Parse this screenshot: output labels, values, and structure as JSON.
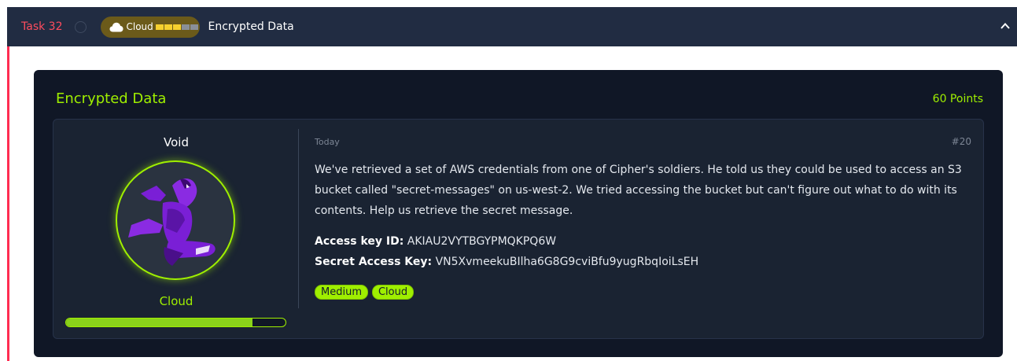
{
  "task": {
    "label": "Task 32",
    "category_pill": "Cloud",
    "difficulty_bars": [
      "#f6d02f",
      "#f6d02f",
      "#f6d02f",
      "#8a8f98",
      "#8a8f98"
    ],
    "title": "Encrypted Data"
  },
  "challenge": {
    "title": "Encrypted Data",
    "points": "60 Points",
    "author": "Void",
    "category": "Cloud",
    "progress": 0.85,
    "date": "Today",
    "message_number": "#20",
    "description": "We've retrieved a set of AWS credentials from one of Cipher's soldiers. He told us they could be used to access an S3 bucket called \"secret-messages\" on us-west-2. We tried accessing the bucket but can't figure out what to do with its contents. Help us retrieve the secret message.",
    "access_key_label": "Access key ID:",
    "access_key_value": "AKIAU2VYTBGYPMQKPQ6W",
    "secret_key_label": "Secret Access Key:",
    "secret_key_value": "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",
    "tags": [
      "Medium",
      "Cloud"
    ]
  },
  "colors": {
    "accent_green": "#9fef00",
    "task_red": "#ff4c5e",
    "header_bg": "#212c42",
    "panel_bg": "#101726",
    "card_bg": "#1a2332"
  },
  "icons": {
    "cloud": "cloud-icon",
    "collapse": "chevron-up-icon",
    "status": "circle-status-icon"
  }
}
